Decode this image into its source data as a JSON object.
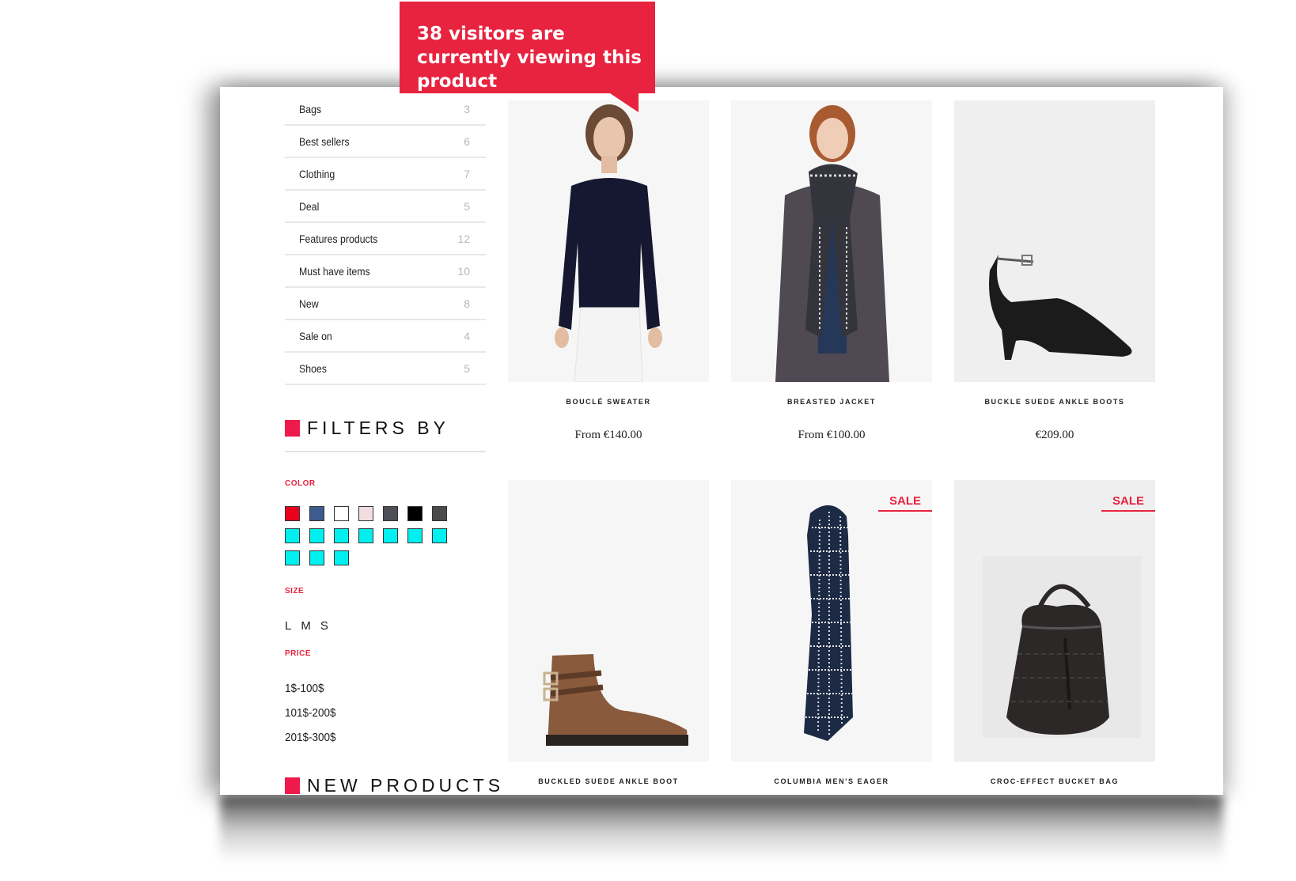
{
  "popup": {
    "text": "38 visitors are currently viewing this product"
  },
  "categories": [
    {
      "label": "Bags",
      "count": "3"
    },
    {
      "label": "Best sellers",
      "count": "6"
    },
    {
      "label": "Clothing",
      "count": "7"
    },
    {
      "label": "Deal",
      "count": "5"
    },
    {
      "label": "Features products",
      "count": "12"
    },
    {
      "label": "Must have items",
      "count": "10"
    },
    {
      "label": "New",
      "count": "8"
    },
    {
      "label": "Sale on",
      "count": "4"
    },
    {
      "label": "Shoes",
      "count": "5"
    }
  ],
  "filters": {
    "title": "FILTERS BY",
    "color_label": "COLOR",
    "colors": [
      "#e8001c",
      "#3e5b8e",
      "#ffffff",
      "#f2dde0",
      "#4d4f55",
      "#000000",
      "#4a4a4a",
      "#00f0f0",
      "#00f0f0",
      "#00f0f0",
      "#00f0f0",
      "#00f0f0",
      "#00f0f0",
      "#00f0f0",
      "#00f0f0",
      "#00f0f0",
      "#00f0f0"
    ],
    "size_label": "SIZE",
    "sizes": [
      "L",
      "M",
      "S"
    ],
    "price_label": "PRICE",
    "prices": [
      "1$-100$",
      "101$-200$",
      "201$-300$"
    ]
  },
  "new_products": {
    "title": "NEW PRODUCTS"
  },
  "products": [
    {
      "name": "BOUCLÉ SWEATER",
      "price": "From €140.00",
      "sale": ""
    },
    {
      "name": "BREASTED JACKET",
      "price": "From €100.00",
      "sale": ""
    },
    {
      "name": "BUCKLE SUEDE ANKLE BOOTS",
      "price": "€209.00",
      "sale": ""
    },
    {
      "name": "BUCKLED SUEDE ANKLE BOOT",
      "price": "",
      "sale": ""
    },
    {
      "name": "COLUMBIA MEN'S EAGER",
      "price": "",
      "sale": "SALE"
    },
    {
      "name": "CROC-EFFECT BUCKET BAG",
      "price": "",
      "sale": "SALE"
    }
  ],
  "accent_color": "#e8233f"
}
